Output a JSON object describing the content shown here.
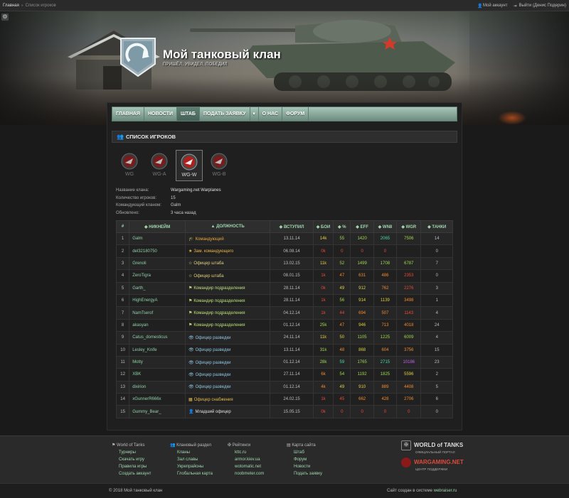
{
  "topbar": {
    "breadcrumb_home": "Главная",
    "breadcrumb_current": "Список игроков",
    "my_account": "Мой аккаунт",
    "logout": "Выйти (Денис Подерин)"
  },
  "header": {
    "clan_name": "Мой танковый клан",
    "slogan": "ПРИШЁЛ, УВИДЕЛ, ПОБЕДИЛ"
  },
  "nav": {
    "items": [
      "ГЛАВНАЯ",
      "НОВОСТИ",
      "ШТАБ",
      "ПОДАТЬ ЗАЯВКУ",
      "О НАС",
      "ФОРУМ"
    ],
    "caret": "▼"
  },
  "section": {
    "title": "СПИСОК ИГРОКОВ"
  },
  "clan_tabs": [
    "WG",
    "WG-A",
    "WG-W",
    "WG-B"
  ],
  "clan_info": {
    "labels": [
      "Название клана:",
      "Количество игроков:",
      "Командующий кланом:",
      "Обновлено:"
    ],
    "values": [
      "Wargaming.net Warplanes",
      "15",
      "Galm",
      "3 часа назад"
    ]
  },
  "table": {
    "headers": [
      "#",
      "◆ НИКНЕЙМ",
      "▲ ДОЛЖНОСТЬ",
      "◆ ВСТУПИЛ",
      "◆ БОИ",
      "◆ %",
      "◆ EFF",
      "◆ WN8",
      "◆ WGR",
      "◆ ТАНКИ"
    ],
    "rows": [
      {
        "n": "1",
        "nick": "Galm",
        "role_icon": "🎓",
        "role": "Командующий",
        "joined": "13.11.14",
        "battles": "14k",
        "pct": "55",
        "eff": "1420",
        "wn8": "2065",
        "wgr": "7506",
        "tanks": "14"
      },
      {
        "n": "2",
        "nick": "del32180750",
        "role_icon": "★",
        "role": "Зам. командующего",
        "joined": "06.08.14",
        "battles": "0k",
        "pct": "0",
        "eff": "0",
        "wn8": "0",
        "wgr": "",
        "tanks": "0"
      },
      {
        "n": "3",
        "nick": "Grenoli",
        "role_icon": "☆",
        "role": "Офицер штаба",
        "joined": "13.02.15",
        "battles": "11k",
        "pct": "52",
        "eff": "1499",
        "wn8": "1708",
        "wgr": "6787",
        "tanks": "7"
      },
      {
        "n": "4",
        "nick": "ZeroTigra",
        "role_icon": "☆",
        "role": "Офицер штаба",
        "joined": "08.01.15",
        "battles": "1k",
        "pct": "47",
        "eff": "631",
        "wn8": "486",
        "wgr": "2353",
        "tanks": "0"
      },
      {
        "n": "5",
        "nick": "Garth_",
        "role_icon": "⚑",
        "role": "Командир подразделения",
        "joined": "28.11.14",
        "battles": "0k",
        "pct": "49",
        "eff": "912",
        "wn8": "762",
        "wgr": "2276",
        "tanks": "3"
      },
      {
        "n": "6",
        "nick": "HighEnergyA",
        "role_icon": "⚑",
        "role": "Командир подразделения",
        "joined": "28.11.14",
        "battles": "1k",
        "pct": "56",
        "eff": "914",
        "wn8": "1139",
        "wgr": "3498",
        "tanks": "1"
      },
      {
        "n": "7",
        "nick": "NamTserof",
        "role_icon": "⚑",
        "role": "Командир подразделения",
        "joined": "04.12.14",
        "battles": "1k",
        "pct": "44",
        "eff": "694",
        "wn8": "507",
        "wgr": "1143",
        "tanks": "4"
      },
      {
        "n": "8",
        "nick": "akasyan",
        "role_icon": "⚑",
        "role": "Командир подразделения",
        "joined": "01.12.14",
        "battles": "25k",
        "pct": "47",
        "eff": "946",
        "wn8": "713",
        "wgr": "4018",
        "tanks": "24"
      },
      {
        "n": "9",
        "nick": "Catus_domesticus",
        "role_icon": "👁",
        "role": "Офицер разведки",
        "joined": "24.11.14",
        "battles": "11k",
        "pct": "50",
        "eff": "1105",
        "wn8": "1225",
        "wgr": "6009",
        "tanks": "4"
      },
      {
        "n": "10",
        "nick": "Lesley_Knife",
        "role_icon": "👁",
        "role": "Офицер разведки",
        "joined": "13.11.14",
        "battles": "31k",
        "pct": "48",
        "eff": "868",
        "wn8": "604",
        "wgr": "3756",
        "tanks": "15"
      },
      {
        "n": "11",
        "nick": "Motty",
        "role_icon": "👁",
        "role": "Офицер разведки",
        "joined": "01.12.14",
        "battles": "28k",
        "pct": "59",
        "eff": "1765",
        "wn8": "2715",
        "wgr": "10186",
        "tanks": "23"
      },
      {
        "n": "12",
        "nick": "XBK",
        "role_icon": "👁",
        "role": "Офицер разведки",
        "joined": "27.11.14",
        "battles": "6k",
        "pct": "54",
        "eff": "1192",
        "wn8": "1825",
        "wgr": "5596",
        "tanks": "2"
      },
      {
        "n": "13",
        "nick": "dixirion",
        "role_icon": "👁",
        "role": "Офицер разведки",
        "joined": "01.12.14",
        "battles": "4k",
        "pct": "49",
        "eff": "910",
        "wn8": "889",
        "wgr": "4408",
        "tanks": "5"
      },
      {
        "n": "14",
        "nick": "xGunnerR666x",
        "role_icon": "▦",
        "role": "Офицер снабжения",
        "joined": "24.02.15",
        "battles": "1k",
        "pct": "45",
        "eff": "662",
        "wn8": "428",
        "wgr": "2706",
        "tanks": "6"
      },
      {
        "n": "15",
        "nick": "Gummy_Bear_",
        "role_icon": "👤",
        "role": "Младший офицер",
        "joined": "15.05.15",
        "battles": "0k",
        "pct": "0",
        "eff": "0",
        "wn8": "0",
        "wgr": "0",
        "tanks": "0"
      }
    ]
  },
  "footer": {
    "cols": [
      {
        "title": "World of Tanks",
        "links": [
          "Турниры",
          "Скачать игру",
          "Правила игры",
          "Создать аккаунт"
        ]
      },
      {
        "title": "Клановый раздел",
        "links": [
          "Кланы",
          "Зал славы",
          "Укрепрайоны",
          "Глобальная карта"
        ]
      },
      {
        "title": "Рейтинги",
        "links": [
          "kttc.ru",
          "armor.kiev.ua",
          "wotomatic.net",
          "noobmeter.com"
        ]
      },
      {
        "title": "Карта сайта",
        "links": [
          "Штаб",
          "Форум",
          "Новости",
          "Подать заявку"
        ]
      }
    ],
    "wot_logo": "WORLD of TANKS",
    "wot_sub": "ОФИЦИАЛЬНЫЙ ПОРТАЛ",
    "wg_logo": "WARGAMING.NET",
    "wg_sub": "ЦЕНТР ПОДДЕРЖКИ",
    "copyright": "© 2018 Мой танковый клан",
    "made_prefix": "Сайт создан в системе",
    "made_brand": "webraiser.ru"
  }
}
